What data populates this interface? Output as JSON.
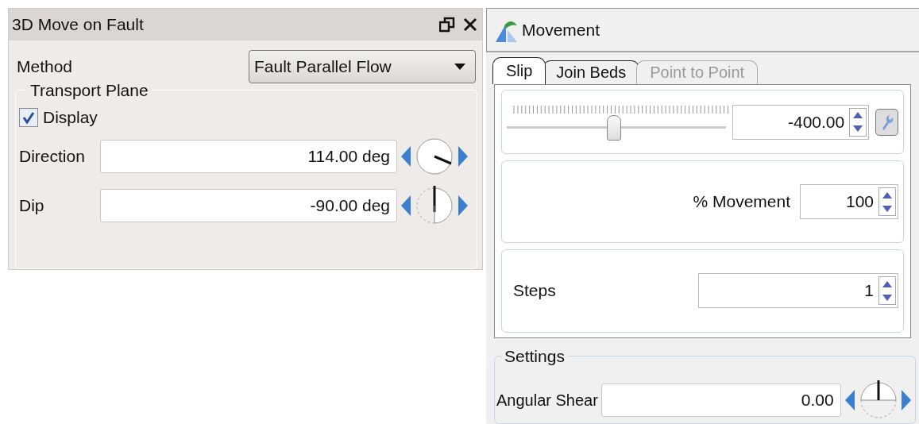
{
  "fault_panel": {
    "title": "3D Move on Fault",
    "method": {
      "label": "Method",
      "value": "Fault Parallel Flow"
    },
    "transport_plane": {
      "title": "Transport Plane",
      "display": {
        "label": "Display",
        "checked": true
      },
      "rows": [
        {
          "label": "Direction",
          "value": "114.00 deg",
          "kind": "direction"
        },
        {
          "label": "Dip",
          "value": "-90.00 deg",
          "kind": "dip"
        }
      ]
    }
  },
  "movement_panel": {
    "title": "Movement",
    "tabs": [
      {
        "label": "Slip",
        "selected": true,
        "disabled": false
      },
      {
        "label": "Join Beds",
        "selected": false,
        "disabled": false
      },
      {
        "label": "Point to Point",
        "selected": false,
        "disabled": true
      }
    ],
    "slip": {
      "level": 0.49,
      "value": "-400.00"
    },
    "percent_movement": {
      "label": "% Movement",
      "value": "100"
    },
    "steps": {
      "label": "Steps",
      "value": "1"
    },
    "settings": {
      "title": "Settings",
      "rows": [
        {
          "label": "Angular Shear",
          "value": "0.00",
          "kind": "shear"
        }
      ]
    }
  }
}
